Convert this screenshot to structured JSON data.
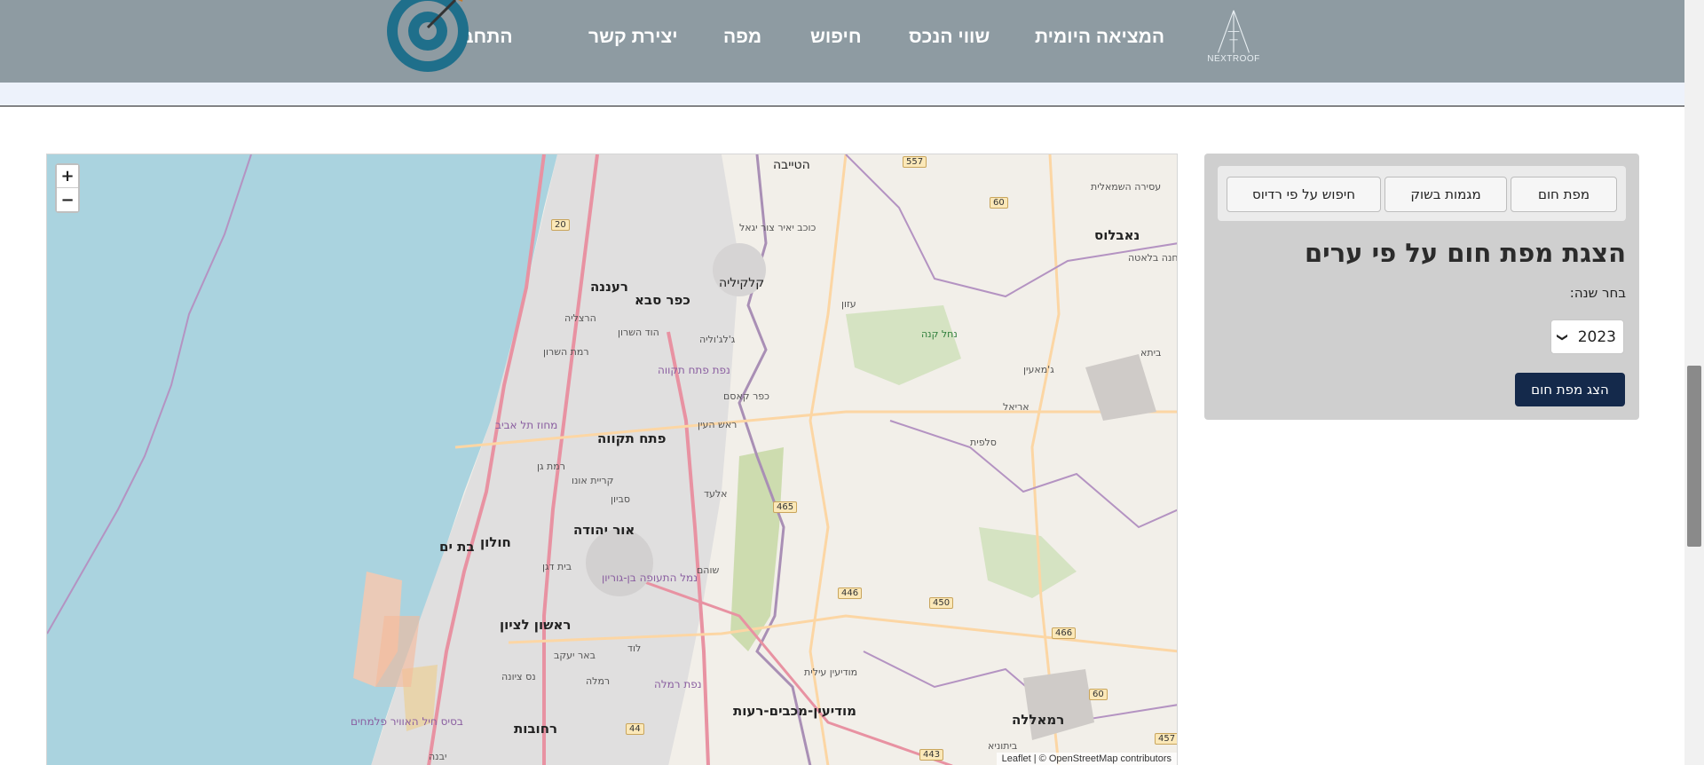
{
  "nav": {
    "logo_text": "NEXTROOF",
    "links": {
      "daily_deal": "המציאה היומית",
      "asset_value": "שווי הנכס",
      "search": "חיפוש",
      "map": "מפה",
      "contact": "יצירת קשר",
      "login": "התחבר"
    },
    "header_bg": "#8e9ba2",
    "target_icon": "target-icon"
  },
  "map": {
    "zoom_in": "+",
    "zoom_out": "−",
    "attribution": "Leaflet | © OpenStreetMap contributors",
    "sea_color": "#aad3df",
    "cities": {
      "taibe": "הטייבה",
      "kochav_yair": "כוכב יאיר צור יגאל",
      "raanana": "רעננה",
      "kfar_saba": "כפר סבא",
      "qalqilya": "קלקיליה",
      "herzliya": "הרצליה",
      "hod_hasharon": "הוד השרון",
      "ramat_hasharon": "רמת השרון",
      "jaljulia": "ג'לג'וליה",
      "petah_tikva_district": "נפת פתח תקווה",
      "kafr_qasim": "כפר קאסם",
      "rosh_haayin": "ראש העין",
      "tel_aviv_district": "מחוז תל אביב",
      "petah_tikva": "פתח תקווה",
      "ramat_gan": "רמת גן",
      "kiryat_ono": "קריית אונו",
      "elad": "אלעד",
      "savyon": "סביון",
      "or_yehuda": "אור יהודה",
      "bat_yam": "בת ים",
      "holon": "חולון",
      "beit_dagan": "בית דגן",
      "ben_gurion": "נמל התעופה בן-גוריון",
      "shoham": "שוהם",
      "rishon": "ראשון לציון",
      "beer_yaakov": "באר יעקב",
      "lod": "לוד",
      "ness_ziona": "נס ציונה",
      "ramla": "רמלה",
      "ramla_district": "נפת רמלה",
      "modiin_illit": "מודיעין עילית",
      "modiin": "מודיעין-מכבים-רעות",
      "rehovot": "רחובות",
      "yavne": "יבנה",
      "ramallah": "רמאללה",
      "nablus": "נאבלוס",
      "ariel": "אריאל",
      "salfit": "סלפית",
      "jamain": "ג'מאעין",
      "azzun": "עזון",
      "betunia": "ביתוניא",
      "beita": "ביתא",
      "asira": "עסירה השמאלית",
      "balata": "מחנה בלאטה",
      "nahal_kana": "נחל קנה",
      "palmachim": "בסיס חיל האוויר פלמחים"
    },
    "roads": [
      "557",
      "60",
      "20",
      "465",
      "446",
      "450",
      "466",
      "60",
      "44",
      "443",
      "457"
    ]
  },
  "panel": {
    "tabs": {
      "heatmap": "מפת חום",
      "trends": "מגמות בשוק",
      "radius_search": "חיפוש על פי רדיוס"
    },
    "title": "הצגת מפת חום על פי ערים",
    "year_label": "בחר שנה:",
    "year_value": "2023",
    "show_button": "הצג מפת חום",
    "button_color": "#14294b"
  }
}
